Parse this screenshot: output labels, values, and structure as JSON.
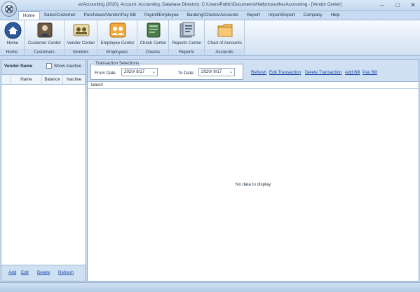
{
  "window": {
    "title": "ezAccounting (2020), Account: Accounting, Database Directory: C:\\Users\\Public\\Documents\\Halfpricesoft\\ezAccounting - [Vendor Center]",
    "minimize": "–",
    "restore": "□",
    "close": "✕"
  },
  "menu": [
    "Home",
    "Sales/Customer",
    "Purchases/Vendor/Pay Bill",
    "Payroll/Employee",
    "Banking/Checks/Accounts",
    "Report",
    "Import/Export",
    "Company",
    "Help"
  ],
  "ribbon": {
    "groups": {
      "home": "Home",
      "customers": "Customers",
      "vendors": "Vendors",
      "employees": "Employees",
      "checks": "Checks",
      "reports": "Reports",
      "accounts": "Accounts"
    },
    "buttons": {
      "home": "Home",
      "customer_center": "Customer Center",
      "vendor_center": "Vendor Center",
      "employee_center": "Employee Center",
      "check_center": "Check Center",
      "reports_center": "Reports Center",
      "chart_of_accounts": "Chart of Accounts"
    }
  },
  "left": {
    "vendor_name": "Vendor Name",
    "show_inactive": "Show Inactive",
    "columns": [
      "Name",
      "Balance",
      "Inactive"
    ],
    "footer": {
      "add": "Add",
      "edit": "Edit",
      "delete": "Delete",
      "refresh": "Refresh"
    }
  },
  "right": {
    "transaction_selections": "Transaction Selections",
    "from_date_label": "From Date",
    "from_date": "2020/ 8/17",
    "to_date_label": "To Date",
    "to_date": "2020/ 9/17",
    "actions": {
      "refresh": "Refresh",
      "edit_transaction": "Edit Transaction",
      "delete_transaction": "Delete Transaction",
      "add_bill": "Add Bill",
      "pay_bill": "Pay Bill"
    },
    "label3": "label3",
    "no_data": "No data to display"
  },
  "colors": {
    "accent": "#1a47a8",
    "panel_header": "#cfe0f3",
    "ribbon_bg": "#dfeaf6"
  }
}
